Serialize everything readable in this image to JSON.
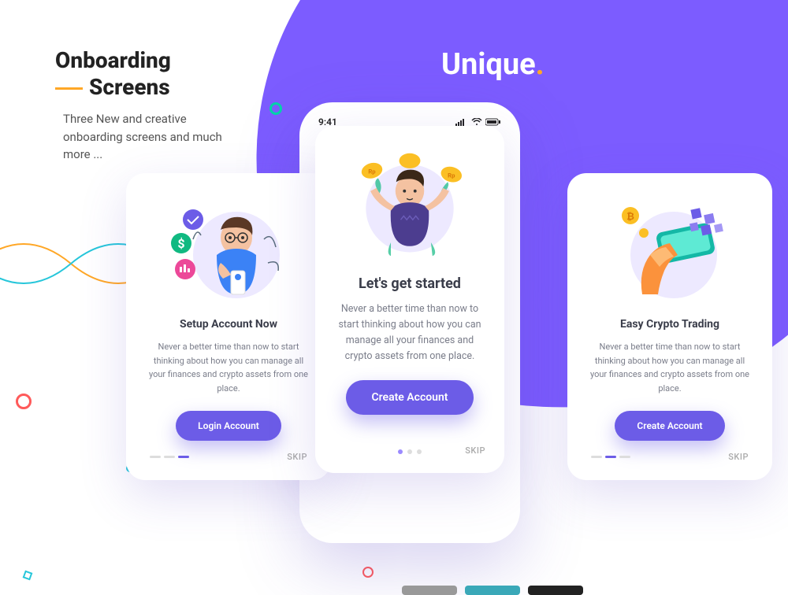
{
  "brand": {
    "name": "Unique",
    "dot": "."
  },
  "heading": {
    "line1": "Onboarding",
    "line2": "Screens"
  },
  "subtitle": "Three New and creative onboarding screens and much more ...",
  "statusBar": {
    "time": "9:41"
  },
  "cards": {
    "left": {
      "title": "Setup Account Now",
      "desc": "Never a better time than now to start thinking about how you can manage all your finances and crypto assets from one place.",
      "button": "Login Account",
      "skip": "SKIP"
    },
    "center": {
      "title": "Let's get started",
      "desc": "Never a better time than now to start thinking about how you can manage all your finances and crypto assets from one place.",
      "button": "Create Account",
      "skip": "SKIP"
    },
    "right": {
      "title": "Easy Crypto Trading",
      "desc": "Never a better time than now to start thinking about how you can manage all your finances and crypto assets from one place.",
      "button": "Create Account",
      "skip": "SKIP"
    }
  }
}
